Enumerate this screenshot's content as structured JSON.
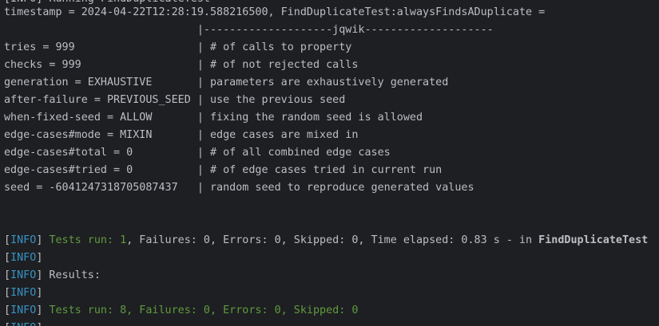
{
  "top_partial": "[INFO] Running FindDuplicateTest",
  "header": {
    "line1": "timestamp = 2024-04-22T12:28:19.588216500, FindDuplicateTest:alwaysFindsADuplicate =",
    "line2": "                              |--------------------jqwik--------------------"
  },
  "params": [
    "tries = 999                   | # of calls to property",
    "checks = 999                  | # of not rejected calls",
    "generation = EXHAUSTIVE       | parameters are exhaustively generated",
    "after-failure = PREVIOUS_SEED | use the previous seed",
    "when-fixed-seed = ALLOW       | fixing the random seed is allowed",
    "edge-cases#mode = MIXIN       | edge cases are mixed in",
    "edge-cases#total = 0          | # of all combined edge cases",
    "edge-cases#tried = 0          | # of edge cases tried in current run",
    "seed = -6041247318705087437   | random seed to reproduce generated values"
  ],
  "log": {
    "open": "[",
    "close": "]",
    "level": "INFO",
    "line1_green": "Tests run: 1",
    "line1_rest": ", Failures: 0, Errors: 0, Skipped: 0, Time elapsed: 0.83 s - in ",
    "line1_class": "FindDuplicateTest",
    "line3_text": " Results:",
    "line5_green": "Tests run: 8, Failures: 0, Errors: 0, Skipped: 0"
  }
}
